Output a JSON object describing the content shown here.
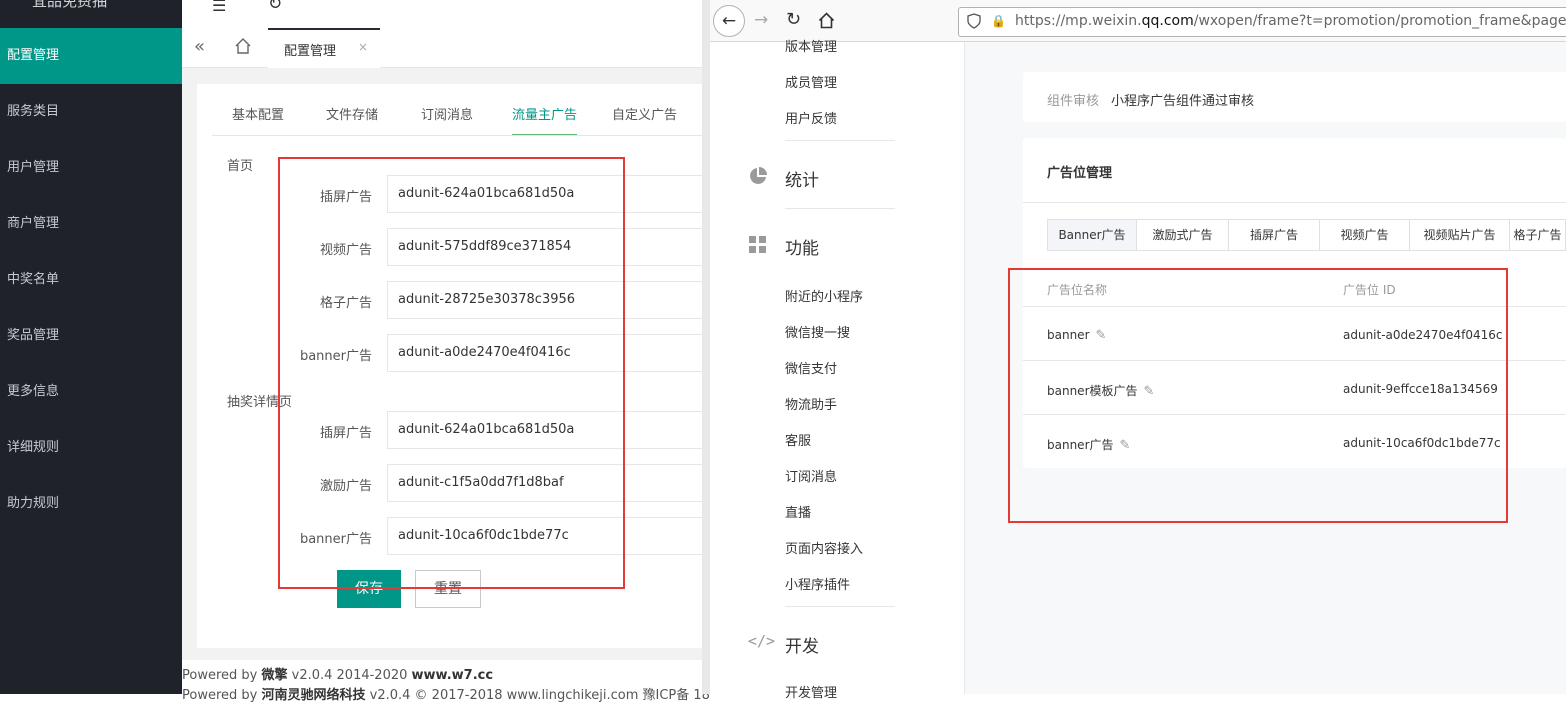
{
  "admin": {
    "brand": "宜品免费抽",
    "nav": [
      "配置管理",
      "服务类目",
      "用户管理",
      "商户管理",
      "中奖名单",
      "奖品管理",
      "更多信息",
      "详细规则",
      "助力规则"
    ],
    "nav_active_index": 0,
    "page_tab": "配置管理",
    "subtabs": [
      "基本配置",
      "文件存储",
      "订阅消息",
      "流量主广告",
      "自定义广告"
    ],
    "subtab_active": "流量主广告",
    "sections": [
      {
        "title": "首页",
        "fields": [
          {
            "label": "插屏广告",
            "value": "adunit-624a01bca681d50a"
          },
          {
            "label": "视频广告",
            "value": "adunit-575ddf89ce371854"
          },
          {
            "label": "格子广告",
            "value": "adunit-28725e30378c3956"
          },
          {
            "label": "banner广告",
            "value": "adunit-a0de2470e4f0416c"
          }
        ]
      },
      {
        "title": "抽奖详情页",
        "fields": [
          {
            "label": "插屏广告",
            "value": "adunit-624a01bca681d50a"
          },
          {
            "label": "激励广告",
            "value": "adunit-c1f5a0dd7f1d8baf"
          },
          {
            "label": "banner广告",
            "value": "adunit-10ca6f0dc1bde77c"
          }
        ]
      }
    ],
    "save_label": "保存",
    "reset_label": "重置",
    "footer": {
      "line1_prefix": "Powered by ",
      "line1_brand": "微擎",
      "line1_version": " v2.0.4 2014-2020 ",
      "line1_site": "www.w7.cc",
      "line2_prefix": "Powered by ",
      "line2_brand": "河南灵驰网络科技",
      "line2_rest": " v2.0.4 © 2017-2018 www.lingchikeji.com 豫ICP备 18"
    }
  },
  "browser": {
    "url_host": "https://mp.weixin.",
    "url_domain": "qq.com",
    "url_path": "/wxopen/frame?t=promotion/promotion_frame&page=ap"
  },
  "wx": {
    "side_top": [
      "版本管理",
      "成员管理",
      "用户反馈"
    ],
    "group_stats": "统计",
    "group_func": "功能",
    "func_items": [
      "附近的小程序",
      "微信搜一搜",
      "微信支付",
      "物流助手",
      "客服",
      "订阅消息",
      "直播",
      "页面内容接入",
      "小程序插件"
    ],
    "group_dev": "开发",
    "dev_items": [
      "开发管理"
    ],
    "review_label": "组件审核",
    "review_value": "小程序广告组件通过审核",
    "ad_title": "广告位管理",
    "ad_tabs": [
      "Banner广告",
      "激励式广告",
      "插屏广告",
      "视频广告",
      "视频贴片广告",
      "格子广告"
    ],
    "ad_tab_active": "Banner广告",
    "table_headers": [
      "广告位名称",
      "广告位 ID"
    ],
    "table_rows": [
      {
        "name": "banner",
        "id": "adunit-a0de2470e4f0416c"
      },
      {
        "name": "banner模板广告",
        "id": "adunit-9effcce18a134569"
      },
      {
        "name": "banner广告",
        "id": "adunit-10ca6f0dc1bde77c"
      }
    ]
  }
}
